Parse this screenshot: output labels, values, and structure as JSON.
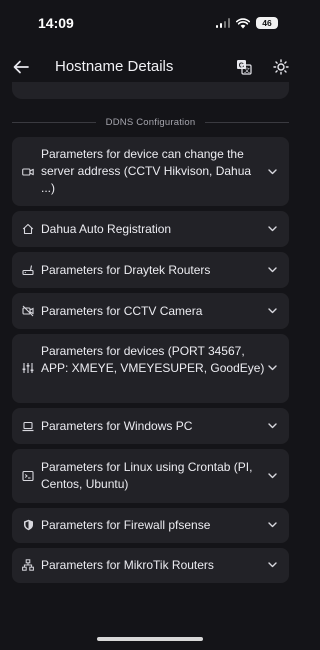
{
  "status": {
    "time": "14:09",
    "battery": "46"
  },
  "header": {
    "title": "Hostname Details"
  },
  "section": {
    "label": "DDNS Configuration"
  },
  "items": [
    {
      "label": "Parameters for device can change the server address (CCTV Hikvison, Dahua ...)",
      "icon": "camera-icon"
    },
    {
      "label": "Dahua Auto Registration",
      "icon": "home-icon"
    },
    {
      "label": "Parameters for Draytek Routers",
      "icon": "router-icon"
    },
    {
      "label": "Parameters for CCTV Camera",
      "icon": "camera-off-icon"
    },
    {
      "label": "Parameters for devices (PORT 34567, APP: XMEYE, VMEYESUPER, GoodEye)",
      "icon": "sliders-icon"
    },
    {
      "label": "Parameters for Windows PC",
      "icon": "laptop-icon"
    },
    {
      "label": "Parameters for Linux using Crontab (PI, Centos, Ubuntu)",
      "icon": "terminal-icon"
    },
    {
      "label": "Parameters for Firewall pfsense",
      "icon": "shield-icon"
    },
    {
      "label": "Parameters for MikroTik Routers",
      "icon": "network-icon"
    }
  ]
}
